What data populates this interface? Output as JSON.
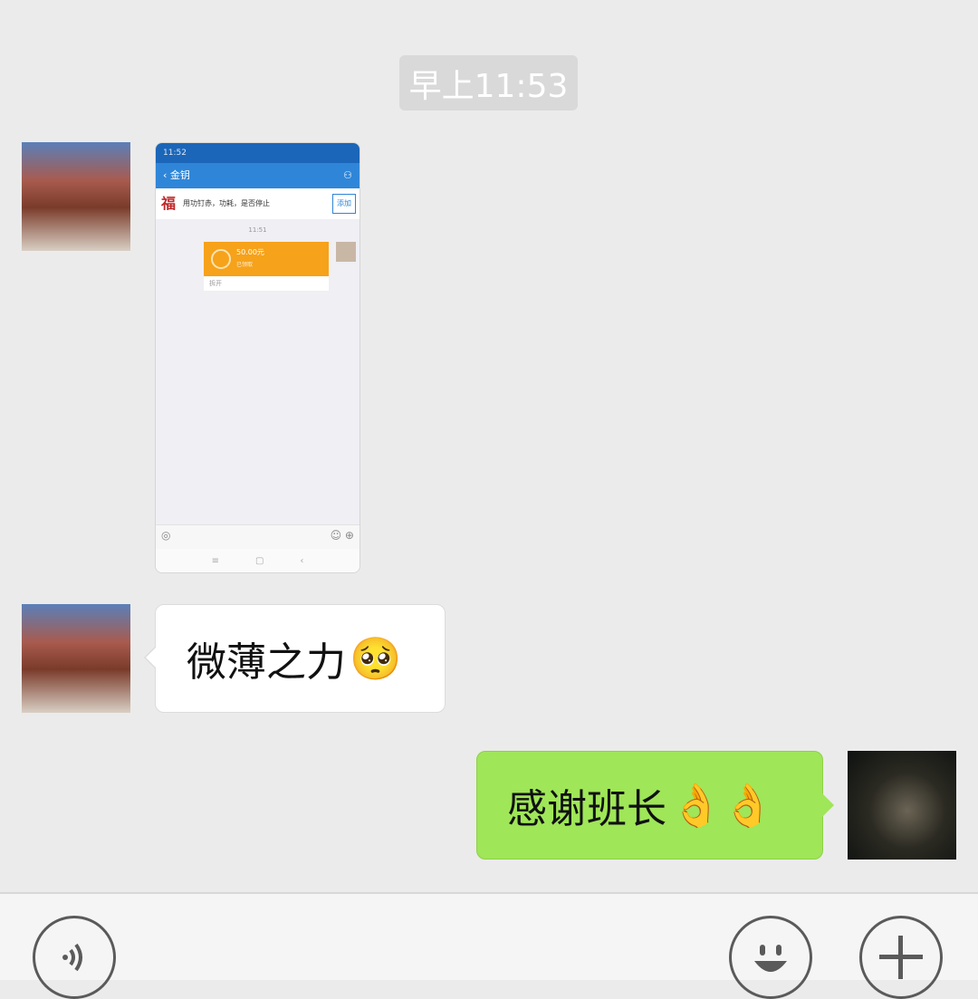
{
  "timestamp": "早上11:53",
  "messages": [
    {
      "type": "image",
      "sender": "other",
      "screenshot": {
        "status_time": "11:52",
        "nav_title": "‹ 金钥",
        "banner_text": "用功钉赤，功耗，是否停止",
        "banner_badge": "福",
        "banner_button": "添加",
        "time": "11:51",
        "amount": "50.00元",
        "amount_sub": "已领取",
        "footer": "拆开"
      }
    },
    {
      "type": "text",
      "sender": "other",
      "text": "微薄之力",
      "emoji": "🥺"
    },
    {
      "type": "text",
      "sender": "self",
      "text": "感谢班长",
      "emoji": "👌👌"
    }
  ],
  "input_bar": {
    "voice_icon": "voice-icon",
    "emoji_icon": "smiley-icon",
    "plus_icon": "plus-icon"
  }
}
